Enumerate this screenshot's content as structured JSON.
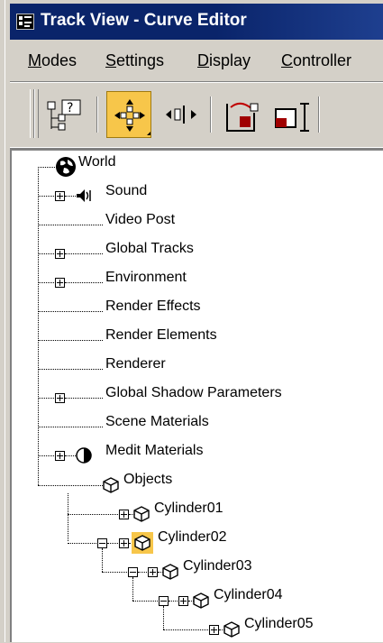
{
  "window": {
    "title": "Track View - Curve Editor"
  },
  "menu": {
    "items": [
      {
        "label": "Modes",
        "underline": "M",
        "rest": "odes"
      },
      {
        "label": "Settings",
        "underline": "S",
        "rest": "ettings"
      },
      {
        "label": "Display",
        "underline": "D",
        "rest": "isplay"
      },
      {
        "label": "Controller",
        "underline": "C",
        "rest": "ontroller"
      }
    ]
  },
  "toolbar": {
    "buttons": [
      {
        "name": "filters",
        "icon": "filters-tree-icon",
        "active": false
      },
      {
        "name": "move-keys",
        "icon": "move-keys-icon",
        "active": true
      },
      {
        "name": "slide-keys",
        "icon": "slide-keys-icon",
        "active": false
      },
      {
        "name": "scale-keys",
        "icon": "scale-keys-icon",
        "active": false
      },
      {
        "name": "scale-values",
        "icon": "scale-values-icon",
        "active": false
      }
    ]
  },
  "tree": {
    "world": "World",
    "sound": "Sound",
    "video_post": "Video Post",
    "global_tracks": "Global Tracks",
    "environment": "Environment",
    "render_effects": "Render Effects",
    "render_elements": "Render Elements",
    "renderer": "Renderer",
    "global_shadow": "Global Shadow Parameters",
    "scene_materials": "Scene Materials",
    "medit_materials": "Medit Materials",
    "objects": "Objects",
    "cylinder01": "Cylinder01",
    "cylinder02": "Cylinder02",
    "cylinder03": "Cylinder03",
    "cylinder04": "Cylinder04",
    "cylinder05": "Cylinder05"
  },
  "colors": {
    "titlebar": "#0a246a",
    "highlight": "#f7c64a",
    "face": "#d4d0c8"
  }
}
